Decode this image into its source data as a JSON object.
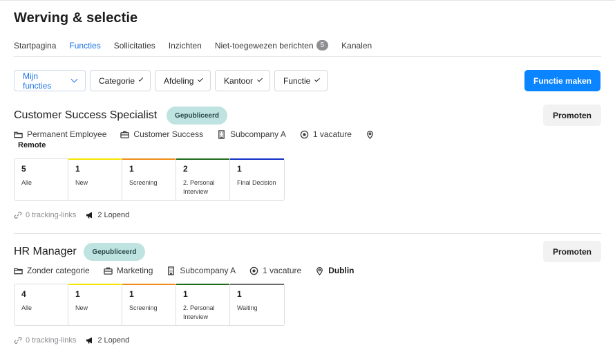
{
  "page_title": "Werving & selectie",
  "tabs": [
    {
      "label": "Startpagina"
    },
    {
      "label": "Functies"
    },
    {
      "label": "Sollicitaties"
    },
    {
      "label": "Inzichten"
    },
    {
      "label": "Niet-toegewezen berichten",
      "badge": "5"
    },
    {
      "label": "Kanalen"
    }
  ],
  "filters": [
    {
      "label": "Mijn functies"
    },
    {
      "label": "Categorie"
    },
    {
      "label": "Afdeling"
    },
    {
      "label": "Kantoor"
    },
    {
      "label": "Functie"
    }
  ],
  "create_button": "Functie maken",
  "colors": {
    "accent": "#0a84ff",
    "status_bg": "#bfe3e0"
  },
  "jobs": [
    {
      "title": "Customer Success Specialist",
      "status": "Gepubliceerd",
      "promote": "Promoten",
      "employment": "Permanent Employee",
      "category": "Customer Success",
      "company": "Subcompany A",
      "vacancies": "1 vacature",
      "location": "Remote",
      "stages": [
        {
          "count": "5",
          "label": "Alle",
          "color": ""
        },
        {
          "count": "1",
          "label": "New",
          "color": "#f5e600"
        },
        {
          "count": "1",
          "label": "Screening",
          "color": "#f08c1a"
        },
        {
          "count": "2",
          "label": "2. Personal Interview",
          "color": "#1e6b1e"
        },
        {
          "count": "1",
          "label": "Final Decision",
          "color": "#1330c8"
        }
      ],
      "tracking": "0 tracking-links",
      "running": "2 Lopend"
    },
    {
      "title": "HR Manager",
      "status": "Gepubliceerd",
      "promote": "Promoten",
      "employment": "Zonder categorie",
      "category": "Marketing",
      "company": "Subcompany A",
      "vacancies": "1 vacature",
      "location": "Dublin",
      "stages": [
        {
          "count": "4",
          "label": "Alle",
          "color": ""
        },
        {
          "count": "1",
          "label": "New",
          "color": "#f5e600"
        },
        {
          "count": "1",
          "label": "Screening",
          "color": "#f08c1a"
        },
        {
          "count": "1",
          "label": "2. Personal Interview",
          "color": "#1e6b1e"
        },
        {
          "count": "1",
          "label": "Waiting",
          "color": "#6b6b6b"
        }
      ],
      "tracking": "0 tracking-links",
      "running": "2 Lopend"
    }
  ]
}
